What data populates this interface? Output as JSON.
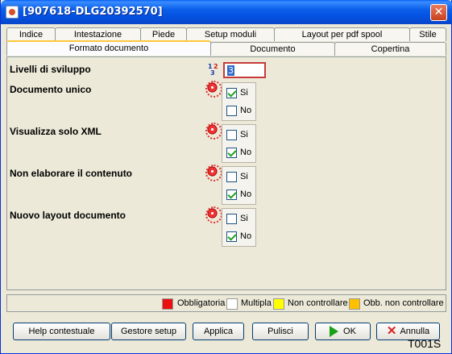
{
  "window": {
    "title": "[907618-DLG20392570]",
    "close_glyph": "✕"
  },
  "tabs_row1": [
    {
      "label": "Indice"
    },
    {
      "label": "Intestazione"
    },
    {
      "label": "Piede"
    },
    {
      "label": "Setup moduli"
    },
    {
      "label": "Layout per pdf spool"
    },
    {
      "label": "Stile"
    }
  ],
  "tabs_row2": [
    {
      "label": "Formato documento",
      "active": true
    },
    {
      "label": "Documento"
    },
    {
      "label": "Copertina"
    }
  ],
  "form": {
    "level_label": "Livelli di sviluppo",
    "level_value": "3",
    "rows": [
      {
        "label": "Documento unico",
        "options": [
          {
            "label": "Si",
            "checked": true
          },
          {
            "label": "No",
            "checked": false
          }
        ]
      },
      {
        "label": "Visualizza solo XML",
        "options": [
          {
            "label": "Si",
            "checked": false
          },
          {
            "label": "No",
            "checked": true
          }
        ]
      },
      {
        "label": "Non elaborare il contenuto",
        "options": [
          {
            "label": "Si",
            "checked": false
          },
          {
            "label": "No",
            "checked": true
          }
        ]
      },
      {
        "label": "Nuovo layout documento",
        "options": [
          {
            "label": "Si",
            "checked": false
          },
          {
            "label": "No",
            "checked": true
          }
        ]
      }
    ]
  },
  "legend": {
    "items": [
      {
        "label": "Obbligatoria",
        "color": "#e81010"
      },
      {
        "label": "Multipla",
        "color": "#ffffff"
      },
      {
        "label": "Non controllare",
        "color": "#ffff00"
      },
      {
        "label": "Obb. non controllare",
        "color": "#ffc000"
      }
    ]
  },
  "buttons": {
    "help": "Help contestuale",
    "setup_manager": "Gestore setup",
    "apply": "Applica",
    "clear": "Pulisci",
    "ok": "OK",
    "cancel": "Annulla"
  },
  "corner_code": "T001S"
}
